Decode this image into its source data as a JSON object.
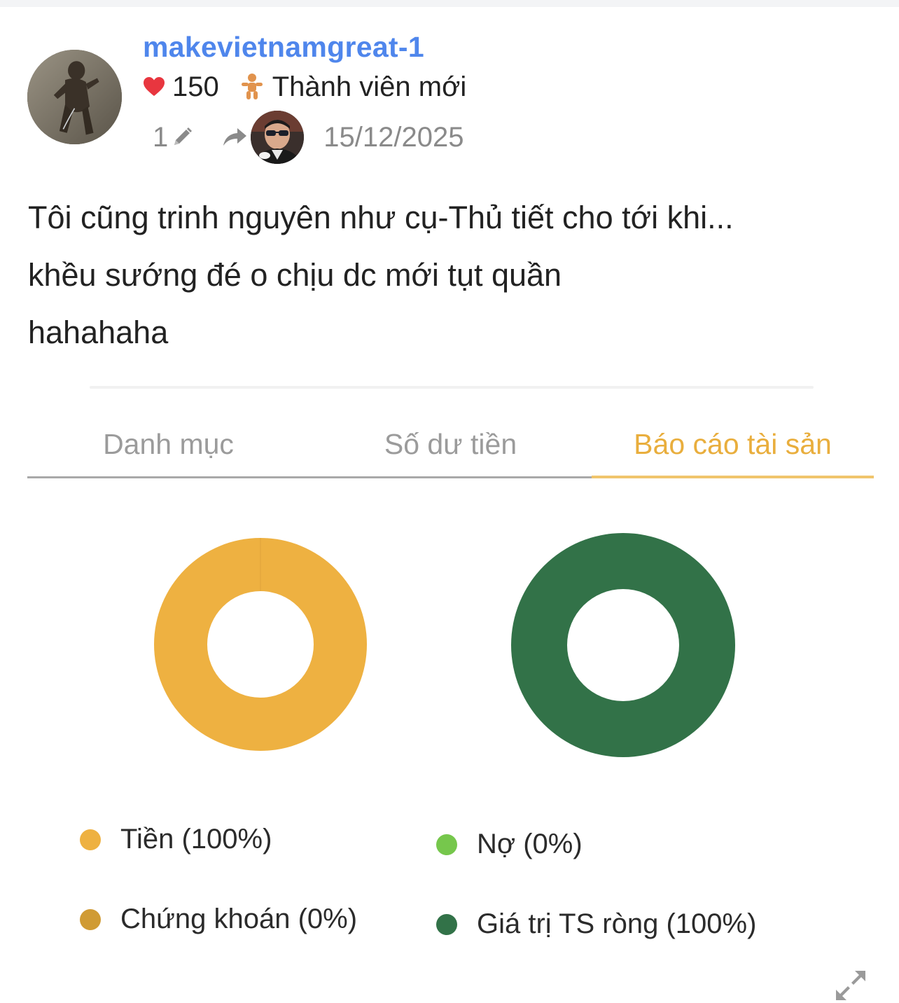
{
  "post": {
    "username": "makevietnamgreat-1",
    "likes": "150",
    "rank": "Thành viên mới",
    "edit_count": "1",
    "date": "15/12/2025",
    "body_lines": [
      "Tôi cũng trinh nguyên như cụ-Thủ tiết cho tới khi...",
      "khều sướng đé o chịu dc mới tụt quần",
      "hahahaha"
    ]
  },
  "icons": {
    "heart": "heart-icon",
    "rank": "baby-icon",
    "edit": "pencil-icon",
    "reply": "reply-icon",
    "expand": "expand-icon"
  },
  "embed": {
    "tabs": [
      {
        "label": "Danh mục",
        "active": false
      },
      {
        "label": "Số dư tiền",
        "active": false
      },
      {
        "label": "Báo cáo tài sản",
        "active": true
      }
    ],
    "charts": [
      {
        "type": "pie",
        "style": "donut",
        "slices": [
          {
            "label": "Tiền (100%)",
            "value": 100,
            "color": "#eeb141"
          },
          {
            "label": "Chứng khoán (0%)",
            "value": 0,
            "color": "#d09b34"
          }
        ]
      },
      {
        "type": "pie",
        "style": "donut",
        "slices": [
          {
            "label": "Nợ (0%)",
            "value": 0,
            "color": "#76c74c"
          },
          {
            "label": "Giá trị TS ròng (100%)",
            "value": 100,
            "color": "#327248"
          }
        ]
      }
    ]
  },
  "colors": {
    "username": "#4f86ec",
    "heart": "#e8363f",
    "active_tab": "#e9ae3d"
  }
}
